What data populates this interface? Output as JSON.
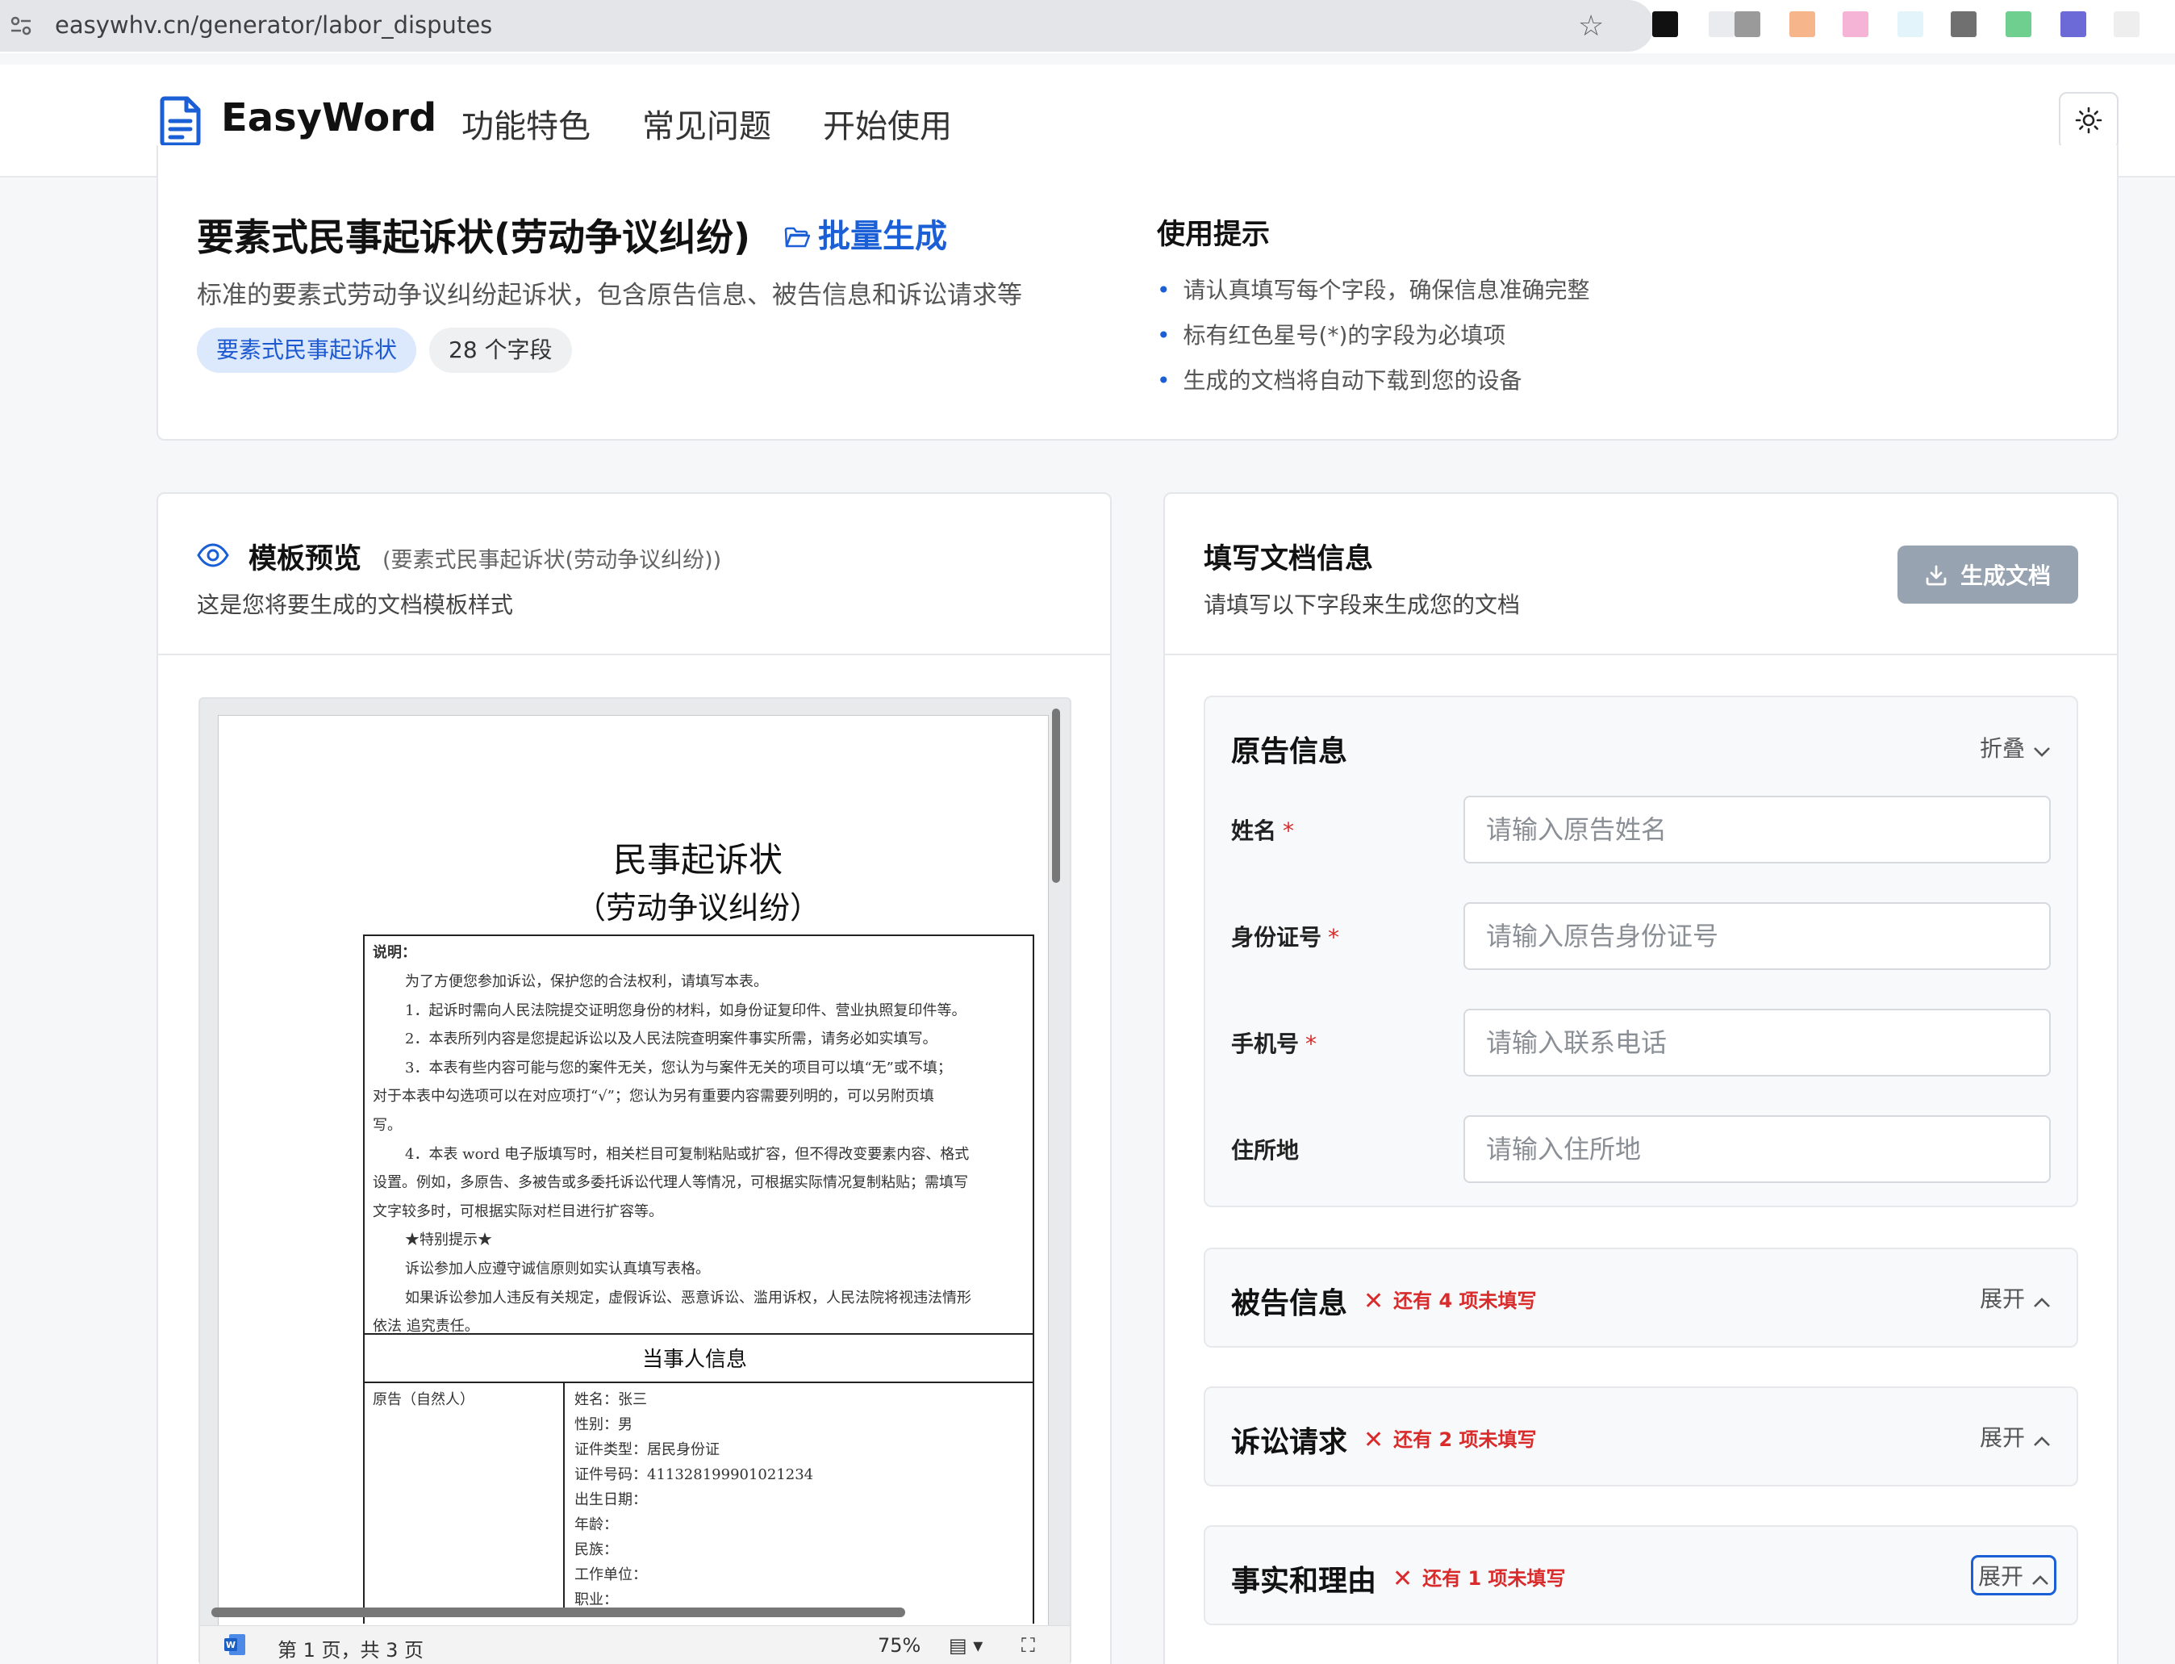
{
  "browser": {
    "url": "easywhv.cn/generator/labor_disputes",
    "extension_colors": [
      "#111111",
      "#e9ebee",
      "#9a9a9a",
      "#f7b58c",
      "#f5b3d6",
      "#e4f4fb",
      "#707070",
      "#6fcf8f",
      "#6b6ad6",
      "#eeeeee"
    ]
  },
  "header": {
    "brand": "EasyWord",
    "nav": [
      "功能特色",
      "常见问题",
      "开始使用"
    ]
  },
  "template": {
    "title": "要素式民事起诉状(劳动争议纠纷)",
    "batch_label": "批量生成",
    "description": "标准的要素式劳动争议纠纷起诉状，包含原告信息、被告信息和诉讼请求等",
    "tag": "要素式民事起诉状",
    "field_count": "28 个字段"
  },
  "tips": {
    "title": "使用提示",
    "items": [
      "请认真填写每个字段，确保信息准确完整",
      "标有红色星号(*)的字段为必填项",
      "生成的文档将自动下载到您的设备"
    ]
  },
  "preview": {
    "title": "模板预览",
    "subtitle": "(要素式民事起诉状(劳动争议纠纷))",
    "description": "这是您将要生成的文档模板样式",
    "doc": {
      "heading": "民事起诉状",
      "subheading": "（劳动争议纠纷）",
      "note_title": "说明：",
      "notes": [
        "为了方便您参加诉讼，保护您的合法权利，请填写本表。",
        "1．起诉时需向人民法院提交证明您身份的材料，如身份证复印件、营业执照复印件等。",
        "2．本表所列内容是您提起诉讼以及人民法院查明案件事实所需，请务必如实填写。",
        "3．本表有些内容可能与您的案件无关，您认为与案件无关的项目可以填“无”或不填；",
        "对于本表中勾选项可以在对应项打“√”；您认为另有重要内容需要列明的，可以另附页填",
        "写。",
        "4．本表 word 电子版填写时，相关栏目可复制粘贴或扩容，但不得改变要素内容、格式",
        "设置。例如，多原告、多被告或多委托诉讼代理人等情况，可根据实际情况复制粘贴；需填写",
        "文字较多时，可根据实际对栏目进行扩容等。",
        "★特别提示★",
        "诉讼参加人应遵守诚信原则如实认真填写表格。",
        "如果诉讼参加人违反有关规定，虚假诉讼、恶意诉讼、滥用诉权，人民法院将视违法情形",
        "依法 追究责任。"
      ],
      "party_header": "当事人信息",
      "party_label": "原告（自然人）",
      "party_fields": [
        "姓名：张三",
        "性别：男",
        "证件类型：居民身份证",
        "证件号码：411328199901021234",
        "出生日期：",
        "年龄：",
        "民族：",
        "工作单位：",
        "职业："
      ]
    },
    "status": {
      "page": "第 1 页，共 3 页",
      "zoom": "75%"
    }
  },
  "form": {
    "title": "填写文档信息",
    "description": "请填写以下字段来生成您的文档",
    "generate_label": "生成文档",
    "sections": [
      {
        "title": "原告信息",
        "toggle": "折叠",
        "fields": [
          {
            "label": "姓名",
            "required": "*",
            "placeholder": "请输入原告姓名"
          },
          {
            "label": "身份证号",
            "required": "*",
            "placeholder": "请输入原告身份证号"
          },
          {
            "label": "手机号",
            "required": "*",
            "placeholder": "请输入联系电话"
          },
          {
            "label": "住所地",
            "required": "",
            "placeholder": "请输入住所地"
          }
        ]
      },
      {
        "title": "被告信息",
        "warning": "还有 4 项未填写",
        "toggle": "展开"
      },
      {
        "title": "诉讼请求",
        "warning": "还有 2 项未填写",
        "toggle": "展开"
      },
      {
        "title": "事实和理由",
        "warning": "还有 1 项未填写",
        "toggle": "展开"
      }
    ]
  }
}
